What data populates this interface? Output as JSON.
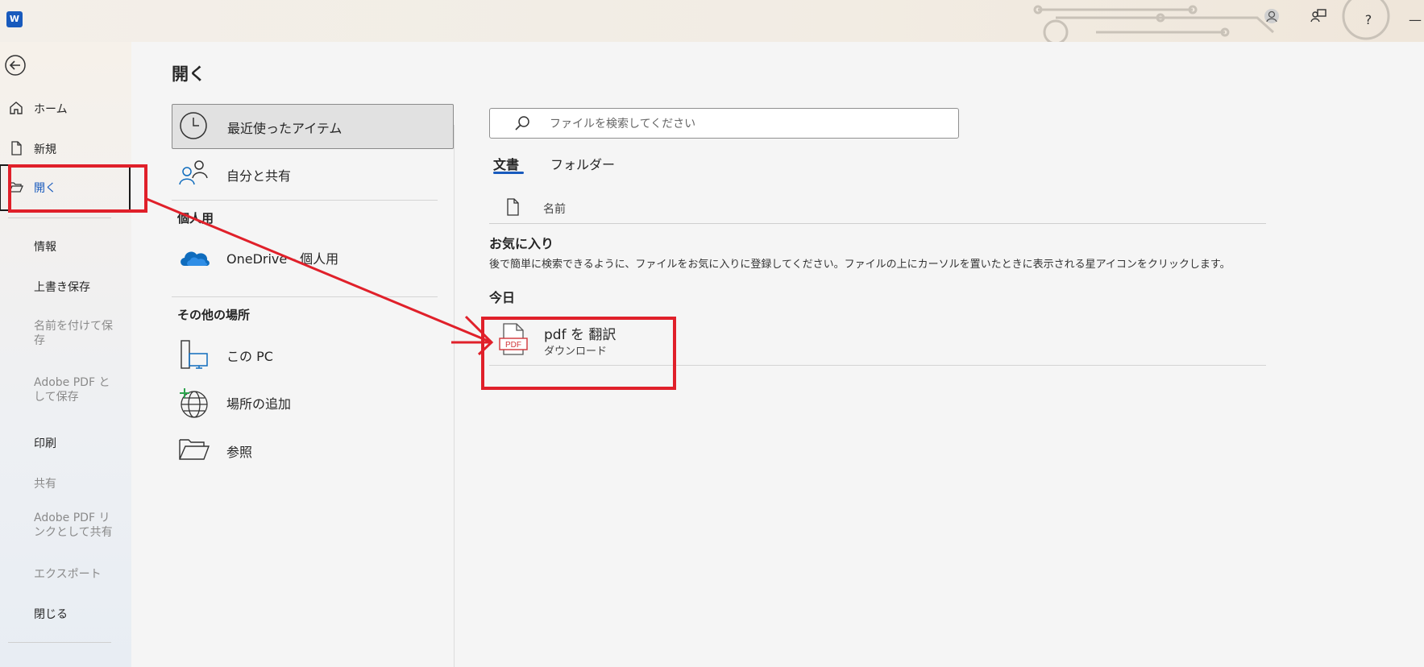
{
  "window": {
    "app_logo_text": "W",
    "help_label": "?",
    "minimize_label": "—"
  },
  "nav": {
    "items": [
      {
        "label": "ホーム"
      },
      {
        "label": "新規"
      },
      {
        "label": "開く"
      },
      {
        "label": "情報"
      },
      {
        "label": "上書き保存"
      },
      {
        "label": "名前を付けて保存"
      },
      {
        "label": "Adobe PDF として保存"
      },
      {
        "label": "印刷"
      },
      {
        "label": "共有"
      },
      {
        "label": "Adobe PDF リンクとして共有"
      },
      {
        "label": "エクスポート"
      },
      {
        "label": "閉じる"
      }
    ]
  },
  "page": {
    "title": "開く"
  },
  "locations": {
    "recent": "最近使ったアイテム",
    "shared": "自分と共有",
    "personal_header": "個人用",
    "onedrive": "OneDrive - 個人用",
    "other_header": "その他の場所",
    "this_pc": "この PC",
    "add_place": "場所の追加",
    "browse": "参照"
  },
  "search": {
    "placeholder": "ファイルを検索してください"
  },
  "tabs": {
    "documents": "文書",
    "folders": "フォルダー"
  },
  "list": {
    "name_header": "名前",
    "favorites_header": "お気に入り",
    "favorites_desc": "後で簡単に検索できるように、ファイルをお気に入りに登録してください。ファイルの上にカーソルを置いたときに表示される星アイコンをクリックします。",
    "today_header": "今日",
    "files": [
      {
        "name": "pdf を 翻訳",
        "location": "ダウンロード",
        "badge": "PDF"
      }
    ]
  },
  "colors": {
    "accent": "#185abd",
    "annotation_red": "#e0202a",
    "onedrive_blue": "#0f6cbd"
  }
}
